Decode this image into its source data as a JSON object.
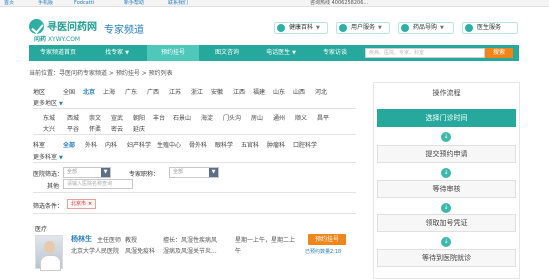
{
  "topbar": {
    "items": [
      "首页",
      "手机版",
      "Fodcatti",
      "新手帮助",
      "联系我们"
    ],
    "phone": "咨询热线 4006258206..."
  },
  "logo": {
    "name": "寻医问药网",
    "domain_prefix": "问药",
    "domain": "XYWY.COM",
    "channel": "专家频道"
  },
  "quick_buttons": [
    {
      "label": "健康百科",
      "icon": "health-icon"
    },
    {
      "label": "用户服务",
      "icon": "user-icon"
    },
    {
      "label": "药品导购",
      "icon": "drug-icon"
    },
    {
      "label": "医生服务",
      "icon": "doctor-icon"
    }
  ],
  "nav": {
    "items": [
      "专家频道首页",
      "找专家",
      "预约挂号",
      "图文咨询",
      "电话医生",
      "专家访谈"
    ],
    "active_index": 2,
    "search_placeholder": "疾病、医院、专家、科室",
    "search_button": "搜索"
  },
  "breadcrumb": "当前位置：寻医问药专家频道 > 预约挂号 > 预约列表",
  "filters": {
    "region_label": "地区",
    "regions_row1": [
      "全国",
      "北京",
      "上海",
      "广东",
      "广西",
      "江苏",
      "浙江",
      "安徽",
      "江西",
      "福建",
      "山东",
      "山西",
      "河北"
    ],
    "selected_region": "北京",
    "expand_label": "更多地区",
    "districts_row1": [
      "东城",
      "西城",
      "崇文",
      "宣武",
      "朝阳",
      "丰台",
      "石景山",
      "海淀",
      "门头沟",
      "房山",
      "通州",
      "顺义",
      "昌平"
    ],
    "districts_row2": [
      "大兴",
      "平谷",
      "怀柔",
      "密云",
      "延庆"
    ],
    "dept_label": "科室",
    "depts": [
      "全部",
      "外科",
      "内科",
      "妇产科学",
      "生殖中心",
      "骨外科",
      "眼科学",
      "五官科",
      "肿瘤科",
      "口腔科学"
    ],
    "selected_dept": "全部",
    "dept_expand": "更多科室",
    "hospital_label": "医院筛选：",
    "hospital_value": "全部",
    "title_label": "专家职称：",
    "title_value": "全部",
    "other_label": "其他",
    "other_placeholder": "请输入医院名称查询",
    "selected_label": "筛选条件：",
    "selected_tag": "北京市",
    "tag_close": "×"
  },
  "doctor": {
    "section_label": "医疗",
    "name": "杨林生",
    "title": "主任医师",
    "role": "教授",
    "hospital": "北京大学人民医院",
    "dept": "风湿免疫科",
    "specialty": "擅长：风湿性疾病风",
    "specialty2": "湿病及风湿关节炎...",
    "schedule": "星期一上午，星期二上",
    "schedule2": "午",
    "book_button": "预约挂号",
    "booked": "已预约数量2:18"
  },
  "sidebar": {
    "title": "操作流程",
    "steps": [
      "选择门诊时间",
      "提交预约申请",
      "等待审核",
      "领取加号凭证",
      "等待到医院就诊"
    ],
    "arrow": "↓"
  }
}
